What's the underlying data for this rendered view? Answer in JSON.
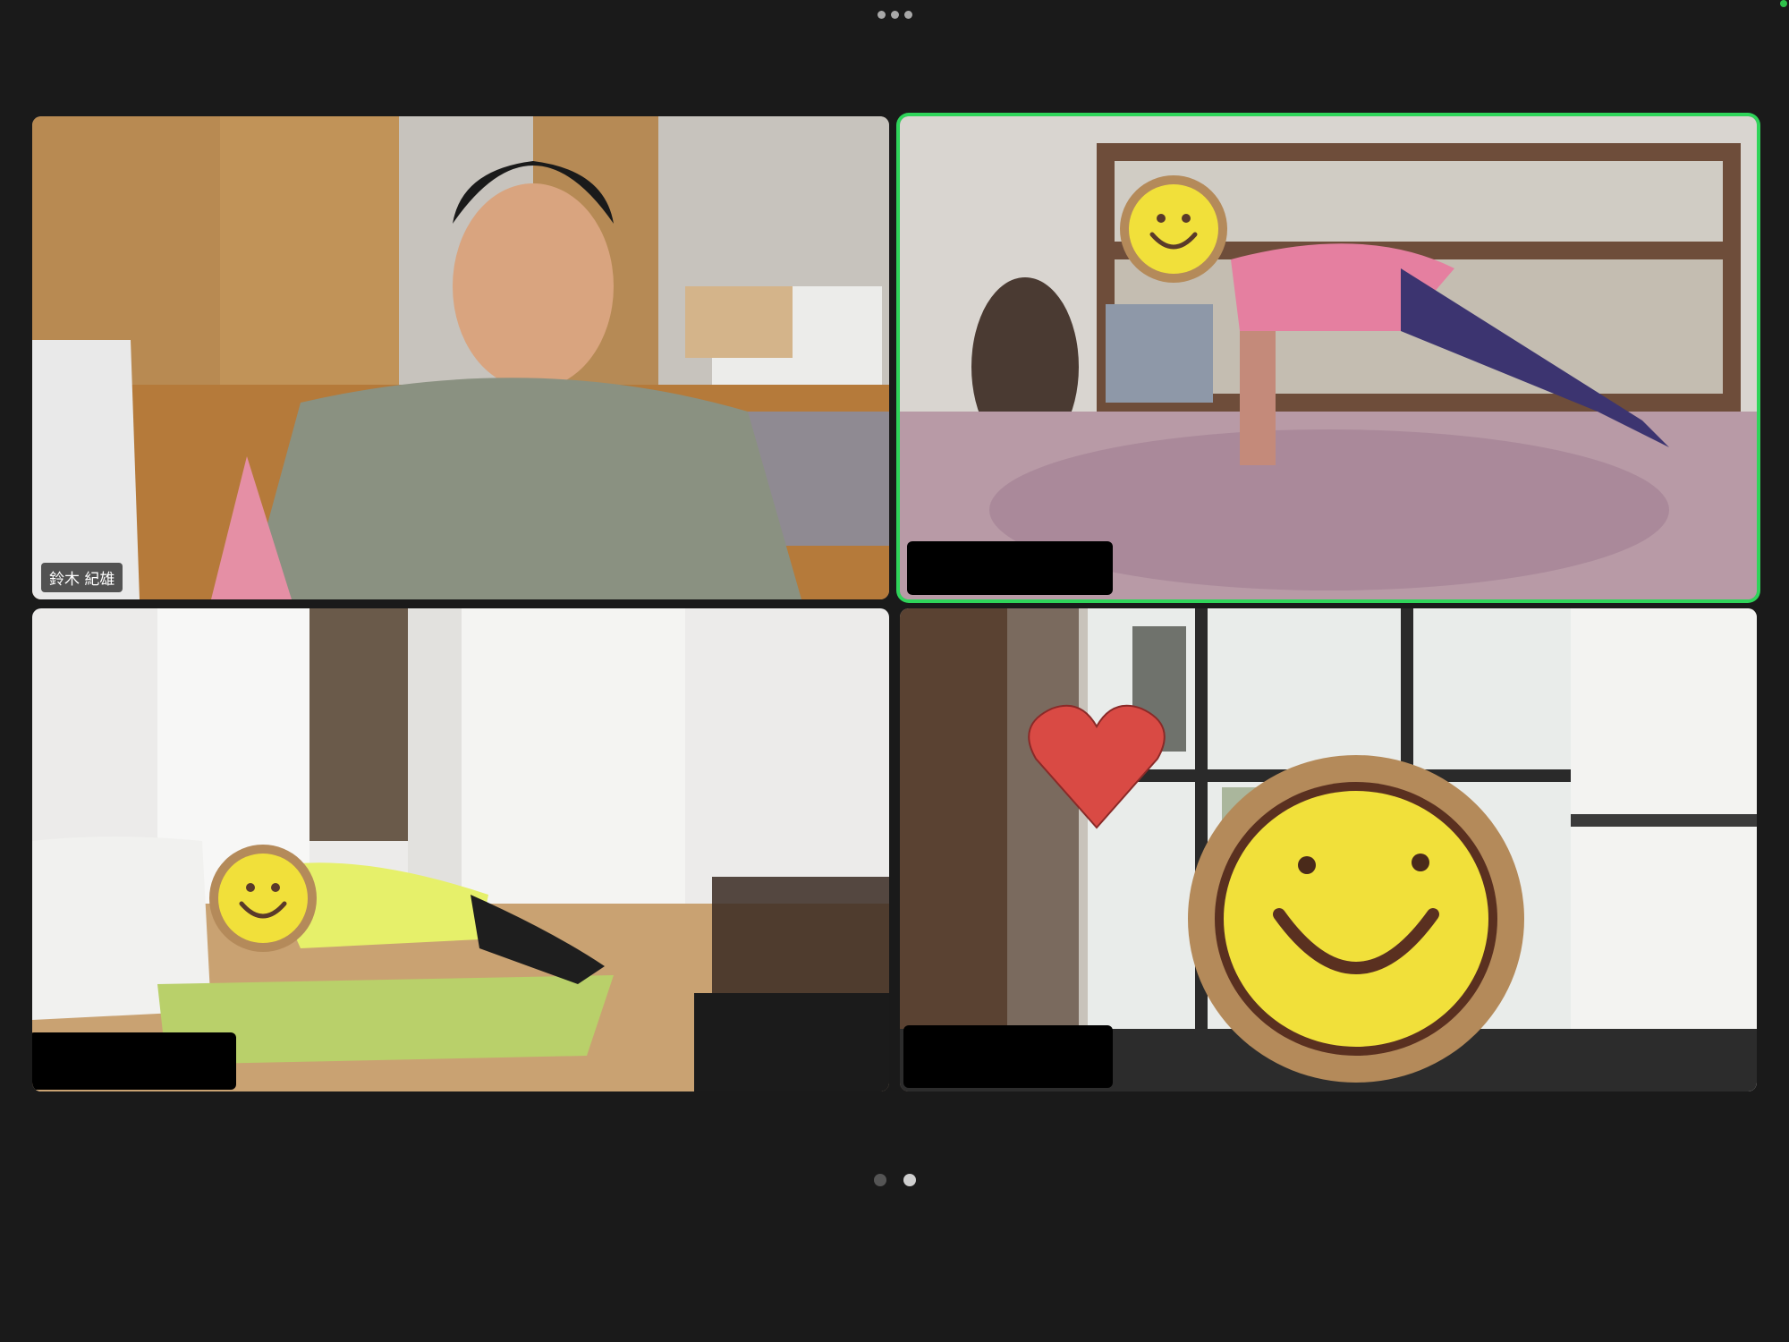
{
  "toolbar": {
    "more_icon": "ellipsis-horizontal-icon"
  },
  "participants": [
    {
      "name": "鈴木 紀雄",
      "name_visible": true,
      "speaking": false
    },
    {
      "name": "",
      "name_visible": false,
      "speaking": true
    },
    {
      "name": "",
      "name_visible": false,
      "speaking": false
    },
    {
      "name": "",
      "name_visible": false,
      "speaking": false
    }
  ],
  "pagination": {
    "pages": 2,
    "current": 2
  },
  "colors": {
    "background": "#1a1a1a",
    "active_speaker_border": "#2fd45a"
  }
}
